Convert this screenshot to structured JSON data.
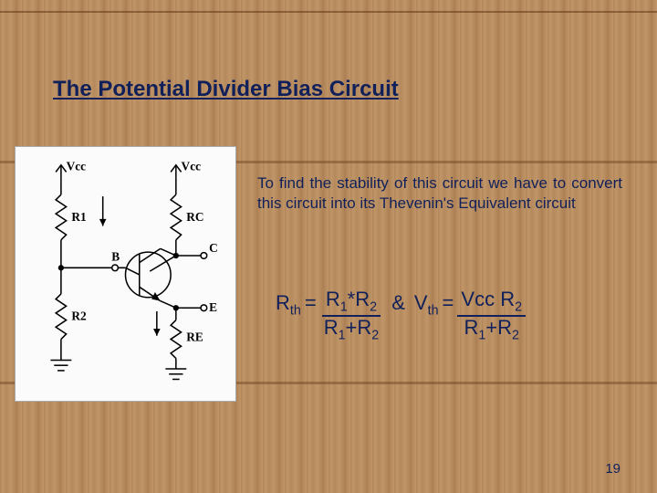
{
  "slide": {
    "title": "The Potential Divider Bias Circuit",
    "paragraph": "To find the stability of this circuit we have to convert this circuit into its Thevenin's Equivalent circuit",
    "formula": {
      "rth_label": "R",
      "rth_sub": "th",
      "eq1": "=",
      "rth_num_a": "R",
      "rth_num_a_sub": "1",
      "rth_num_star": "*",
      "rth_num_b": "R",
      "rth_num_b_sub": "2",
      "rth_den_a": "R",
      "rth_den_a_sub": "1",
      "rth_den_plus": "+",
      "rth_den_b": "R",
      "rth_den_b_sub": "2",
      "amp": "&",
      "vth_label": "V",
      "vth_sub": "th",
      "eq2": "=",
      "vth_num_a": "Vcc R",
      "vth_num_a_sub": "2",
      "vth_den_a": "R",
      "vth_den_a_sub": "1",
      "vth_den_plus": "+",
      "vth_den_b": "R",
      "vth_den_b_sub": "2"
    },
    "page_number": "19"
  },
  "circuit": {
    "labels": {
      "vcc_left": "Vcc",
      "vcc_right": "Vcc",
      "r1": "R1",
      "r2": "R2",
      "rc": "RC",
      "re": "RE",
      "b": "B",
      "c": "C",
      "e": "E"
    }
  }
}
